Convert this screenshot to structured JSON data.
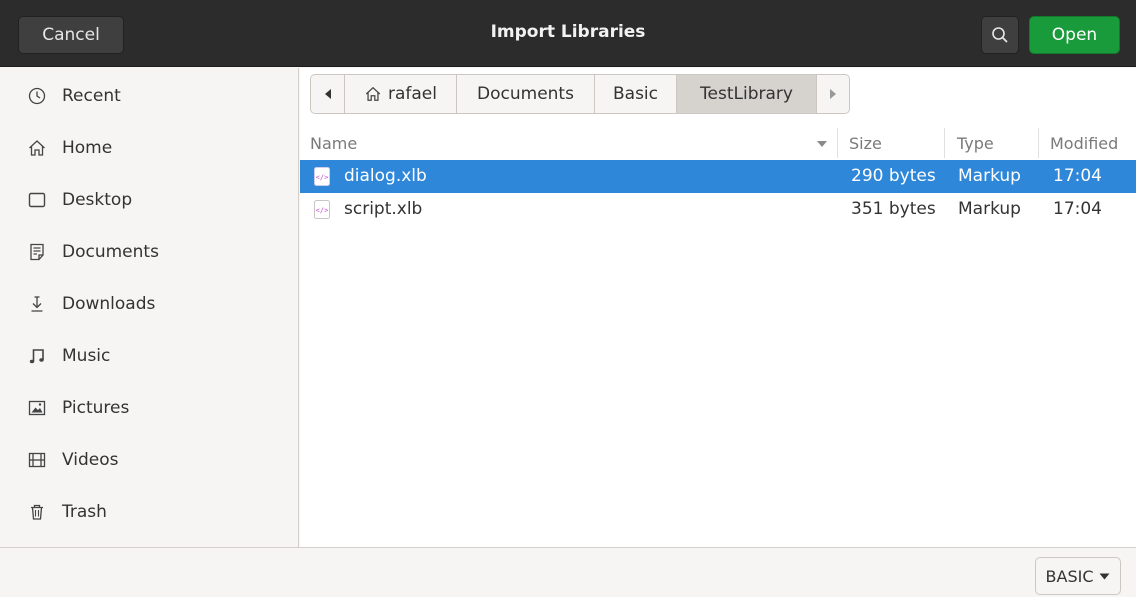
{
  "header": {
    "cancel_label": "Cancel",
    "title": "Import Libraries",
    "open_label": "Open"
  },
  "sidebar": {
    "items": [
      {
        "label": "Recent",
        "icon": "clock-icon"
      },
      {
        "label": "Home",
        "icon": "home-icon"
      },
      {
        "label": "Desktop",
        "icon": "desktop-icon"
      },
      {
        "label": "Documents",
        "icon": "documents-icon"
      },
      {
        "label": "Downloads",
        "icon": "downloads-icon"
      },
      {
        "label": "Music",
        "icon": "music-icon"
      },
      {
        "label": "Pictures",
        "icon": "pictures-icon"
      },
      {
        "label": "Videos",
        "icon": "videos-icon"
      },
      {
        "label": "Trash",
        "icon": "trash-icon"
      }
    ]
  },
  "pathbar": {
    "segments": [
      "rafael",
      "Documents",
      "Basic",
      "TestLibrary"
    ],
    "active": "TestLibrary"
  },
  "columns": {
    "name": "Name",
    "size": "Size",
    "type": "Type",
    "modified": "Modified"
  },
  "files": [
    {
      "name": "dialog.xlb",
      "size": "290 bytes",
      "type": "Markup",
      "modified": "17:04",
      "selected": true
    },
    {
      "name": "script.xlb",
      "size": "351 bytes",
      "type": "Markup",
      "modified": "17:04",
      "selected": false
    }
  ],
  "footer": {
    "filter_label": "BASIC"
  },
  "colors": {
    "header_bg": "#2c2c2c",
    "open_button": "#1a9b3b",
    "selection": "#2f87d9"
  }
}
